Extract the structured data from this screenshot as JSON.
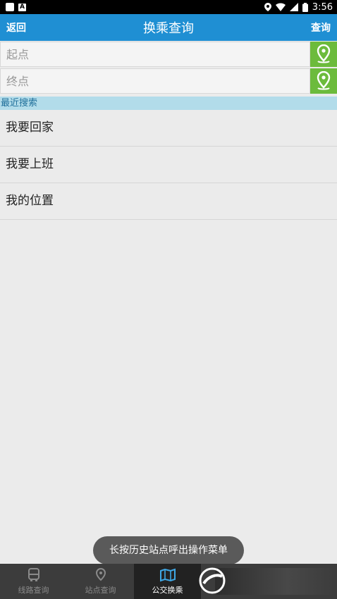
{
  "status_bar": {
    "time": "3:56"
  },
  "header": {
    "back_label": "返回",
    "title": "换乘查询",
    "query_label": "查询"
  },
  "start_field": {
    "placeholder": "起点",
    "value": ""
  },
  "end_field": {
    "placeholder": "终点",
    "value": ""
  },
  "recent": {
    "heading": "最近搜索",
    "items": [
      {
        "label": "我要回家"
      },
      {
        "label": "我要上班"
      },
      {
        "label": "我的位置"
      }
    ]
  },
  "toast": {
    "text": "长按历史站点呼出操作菜单"
  },
  "tabs": [
    {
      "label": "线路查询",
      "icon": "bus-icon",
      "active": false
    },
    {
      "label": "站点查询",
      "icon": "location-pin-icon",
      "active": false
    },
    {
      "label": "公交换乘",
      "icon": "map-icon",
      "active": true
    }
  ],
  "colors": {
    "header": "#1f8fd3",
    "pin_button": "#6cbb3c",
    "recent_header": "#b2dcea",
    "tabbar": "#3c3c3c"
  }
}
